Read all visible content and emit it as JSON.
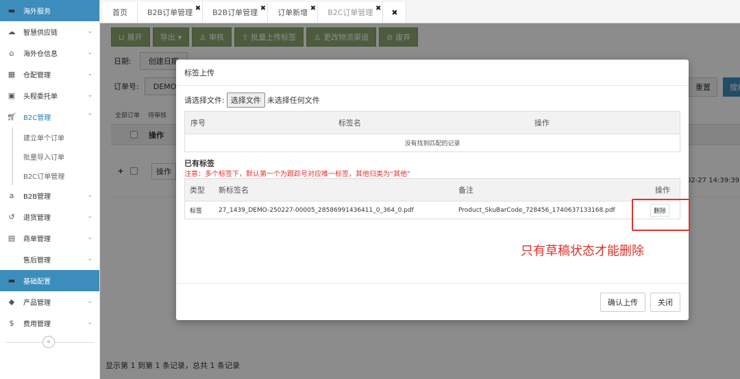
{
  "sidebar": {
    "items": [
      {
        "label": "海外服务",
        "icon": "folder-icon"
      },
      {
        "label": "智慧供应链",
        "icon": "cloud-icon"
      },
      {
        "label": "海外仓信息",
        "icon": "home-icon"
      },
      {
        "label": "仓配管理",
        "icon": "grid-icon"
      },
      {
        "label": "头程委托单",
        "icon": "briefcase-icon"
      },
      {
        "label": "B2C管理",
        "icon": "cart-icon"
      },
      {
        "label": "B2B管理",
        "icon": "amazon-icon"
      },
      {
        "label": "退货管理",
        "icon": "undo-icon"
      },
      {
        "label": "商单管理",
        "icon": "document-icon"
      },
      {
        "label": "售后管理",
        "icon": ""
      },
      {
        "label": "基础配置",
        "icon": "folder-icon"
      },
      {
        "label": "产品管理",
        "icon": "tag-icon"
      },
      {
        "label": "费用管理",
        "icon": "dollar-icon"
      }
    ],
    "b2c_sub": [
      "建立单个订单",
      "批量导入订单",
      "B2C订单管理"
    ],
    "collapse": "«"
  },
  "tabs": [
    {
      "label": "首页"
    },
    {
      "label": "B2B订单管理"
    },
    {
      "label": "B2B订单管理"
    },
    {
      "label": "订单新增"
    },
    {
      "label": "B2C订单管理"
    }
  ],
  "tab_close": "✖",
  "toolbar": {
    "expand": "展开",
    "export": "导出",
    "audit": "审核",
    "batch_upload": "批量上传标签",
    "change_channel": "更改物流渠道",
    "discard": "废弃"
  },
  "filters": {
    "date_label": "日期:",
    "date_value": "创建日期",
    "order_label": "订单号:",
    "order_value": "DEMO-"
  },
  "buttons": {
    "reset": "重置",
    "search": "搜索"
  },
  "bg_table": {
    "tabs": [
      "全部订单",
      "待审核"
    ],
    "op_header": "操作",
    "row_op": "操作",
    "row_date": "02-27 14:39:39"
  },
  "footer_info": "显示第 1 到第 1 条记录，总共 1 条记录",
  "modal": {
    "title": "标签上传",
    "file_label": "请选择文件:",
    "file_button": "选择文件",
    "file_none": "未选择任何文件",
    "table1_headers": [
      "序号",
      "标签名",
      "操作"
    ],
    "table1_empty": "没有找到匹配的记录",
    "existing_title": "已有标签",
    "note": "注意：多个标签下，默认第一个为跟踪号对应唯一标签，其他归类为“其他”",
    "table2_headers": [
      "类型",
      "新标签名",
      "备注",
      "操作"
    ],
    "table2_rows": [
      {
        "type": "标签",
        "name": "27_1439_DEMO-250227-00005_28586991436411_0_364_0.pdf",
        "remark": "Product_SkuBarCode_728456_1740637133168.pdf",
        "action": "删除"
      }
    ],
    "confirm": "确认上传",
    "close": "关闭"
  },
  "annotation": "只有草稿状态才能删除",
  "colors": {
    "sidebar_active": "#3c8dbc",
    "toolbar_green": "#8aa86f",
    "annotation_red": "#e0302a"
  }
}
